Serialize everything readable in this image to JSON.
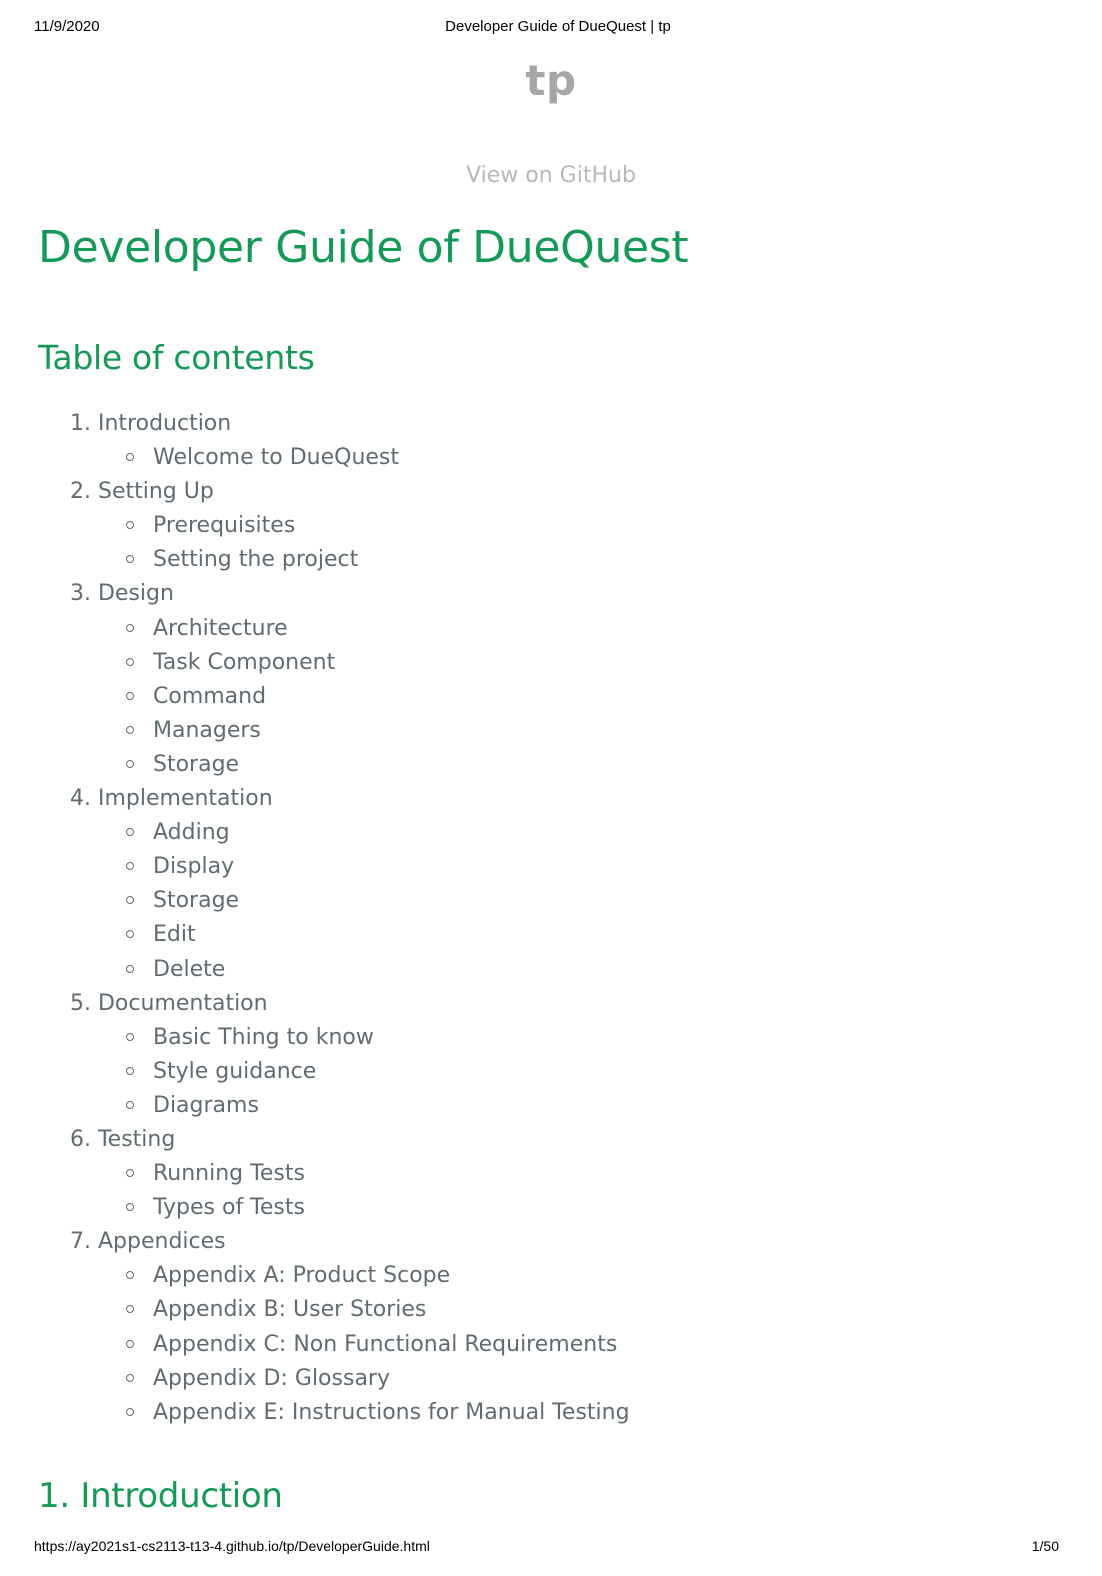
{
  "print_header": {
    "date": "11/9/2020",
    "title": "Developer Guide of DueQuest | tp"
  },
  "site": {
    "title": "tp",
    "github_link": "View on GitHub"
  },
  "main_title": "Developer Guide of DueQuest",
  "toc": {
    "heading": "Table of contents",
    "sections": [
      {
        "label": "1. Introduction",
        "items": [
          "Welcome to DueQuest"
        ]
      },
      {
        "label": "2. Setting Up",
        "items": [
          "Prerequisites",
          "Setting the project"
        ]
      },
      {
        "label": "3. Design",
        "items": [
          "Architecture",
          "Task Component",
          "Command",
          "Managers",
          "Storage"
        ]
      },
      {
        "label": "4. Implementation",
        "items": [
          "Adding",
          "Display",
          "Storage",
          "Edit",
          "Delete"
        ]
      },
      {
        "label": "5. Documentation",
        "items": [
          "Basic Thing to know",
          "Style guidance",
          "Diagrams"
        ]
      },
      {
        "label": "6. Testing",
        "items": [
          "Running Tests",
          "Types of Tests"
        ]
      },
      {
        "label": "7. Appendices",
        "items": [
          "Appendix A: Product Scope",
          "Appendix B: User Stories",
          "Appendix C: Non Functional Requirements",
          "Appendix D: Glossary",
          "Appendix E: Instructions for Manual Testing"
        ]
      }
    ]
  },
  "section_heading": "1. Introduction",
  "print_footer": {
    "url": "https://ay2021s1-cs2113-t13-4.github.io/tp/DeveloperGuide.html",
    "page": "1/50"
  },
  "colors": {
    "heading": "#159957",
    "body_text": "#606c71",
    "site_title": "#a6a6a6",
    "github_link": "#b8b8b8"
  }
}
